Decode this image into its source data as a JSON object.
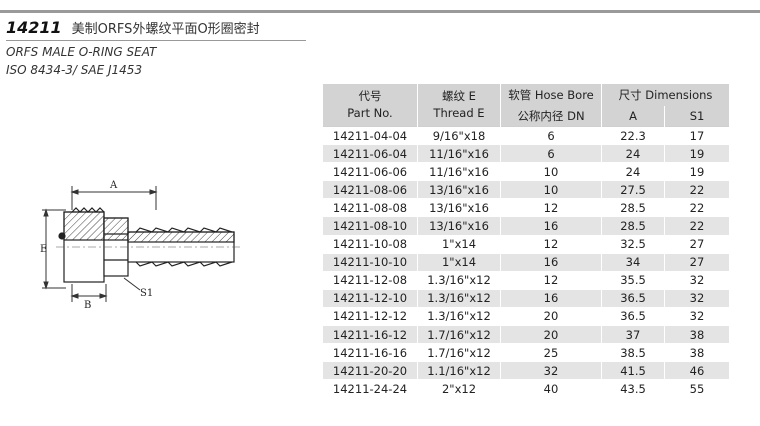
{
  "header": {
    "part_code": "14211",
    "title_cn": "美制ORFS外螺纹平面O形圈密封",
    "subtitle_en": "ORFS MALE O-RING SEAT",
    "standard": "ISO 8434-3/ SAE J1453"
  },
  "drawing": {
    "label_a": "A",
    "label_b": "B",
    "label_e": "E",
    "label_s1": "S1"
  },
  "table": {
    "headers": {
      "part_cn": "代号",
      "part_en": "Part No.",
      "thread_cn": "螺纹 E",
      "thread_en": "Thread E",
      "hose_bore": "软管 Hose Bore",
      "dn": "公称内径 DN",
      "dimensions": "尺寸 Dimensions",
      "a": "A",
      "s1": "S1"
    },
    "rows": [
      {
        "part": "14211-04-04",
        "thread": "9/16\"x18",
        "dn": "6",
        "a": "22.3",
        "s1": "17"
      },
      {
        "part": "14211-06-04",
        "thread": "11/16\"x16",
        "dn": "6",
        "a": "24",
        "s1": "19"
      },
      {
        "part": "14211-06-06",
        "thread": "11/16\"x16",
        "dn": "10",
        "a": "24",
        "s1": "19"
      },
      {
        "part": "14211-08-06",
        "thread": "13/16\"x16",
        "dn": "10",
        "a": "27.5",
        "s1": "22"
      },
      {
        "part": "14211-08-08",
        "thread": "13/16\"x16",
        "dn": "12",
        "a": "28.5",
        "s1": "22"
      },
      {
        "part": "14211-08-10",
        "thread": "13/16\"x16",
        "dn": "16",
        "a": "28.5",
        "s1": "22"
      },
      {
        "part": "14211-10-08",
        "thread": "1\"x14",
        "dn": "12",
        "a": "32.5",
        "s1": "27"
      },
      {
        "part": "14211-10-10",
        "thread": "1\"x14",
        "dn": "16",
        "a": "34",
        "s1": "27"
      },
      {
        "part": "14211-12-08",
        "thread": "1.3/16\"x12",
        "dn": "12",
        "a": "35.5",
        "s1": "32"
      },
      {
        "part": "14211-12-10",
        "thread": "1.3/16\"x12",
        "dn": "16",
        "a": "36.5",
        "s1": "32"
      },
      {
        "part": "14211-12-12",
        "thread": "1.3/16\"x12",
        "dn": "20",
        "a": "36.5",
        "s1": "32"
      },
      {
        "part": "14211-16-12",
        "thread": "1.7/16\"x12",
        "dn": "20",
        "a": "37",
        "s1": "38"
      },
      {
        "part": "14211-16-16",
        "thread": "1.7/16\"x12",
        "dn": "25",
        "a": "38.5",
        "s1": "38"
      },
      {
        "part": "14211-20-20",
        "thread": "1.1/16\"x12",
        "dn": "32",
        "a": "41.5",
        "s1": "46"
      },
      {
        "part": "14211-24-24",
        "thread": "2\"x12",
        "dn": "40",
        "a": "43.5",
        "s1": "55"
      }
    ]
  }
}
